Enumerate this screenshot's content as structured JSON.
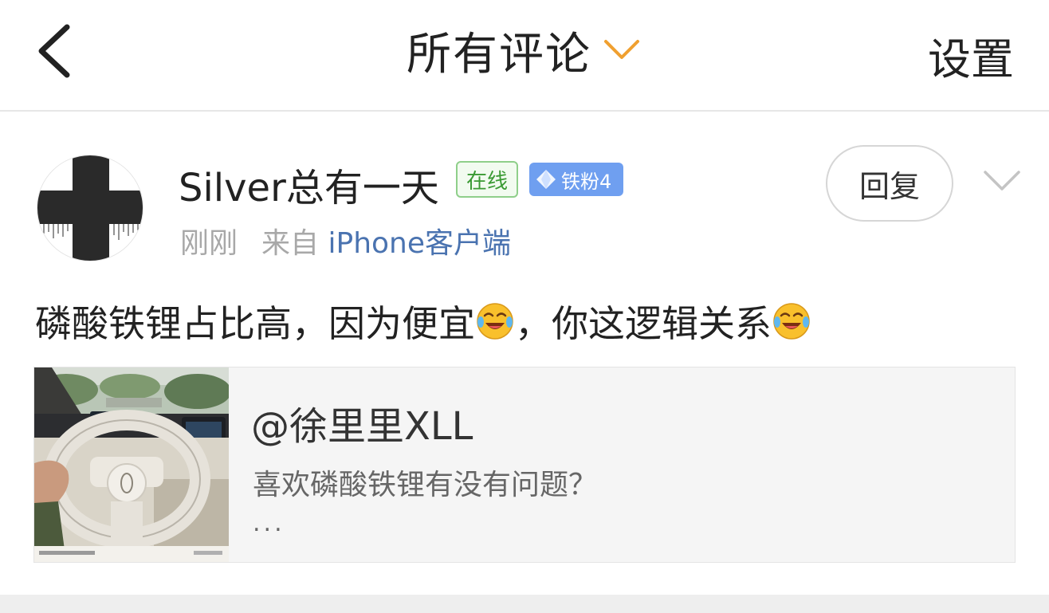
{
  "nav": {
    "back_icon": "chevron-left-icon",
    "title": "所有评论",
    "title_chevron_icon": "chevron-down-icon",
    "settings_label": "设置",
    "accent_color": "#f0a030"
  },
  "comment": {
    "avatar_icon": "cross-avatar",
    "username": "Silver总有一天",
    "online_badge": "在线",
    "fan_badge": "铁粉4",
    "fan_badge_icon": "diamond-icon",
    "time": "刚刚",
    "source_prefix": "来自",
    "source_client": "iPhone客户端",
    "reply_button": "回复",
    "more_icon": "chevron-down-icon",
    "text_part1": "磷酸铁锂占比高，因为便宜",
    "text_part2": "，你这逻辑关系",
    "emoji_icon": "laugh-cry-emoji"
  },
  "quoted_post": {
    "thumbnail": "car-interior-steering-wheel-photo",
    "author": "@徐里里XLL",
    "text": "喜欢磷酸铁锂有没有问题？",
    "ellipsis": "..."
  }
}
